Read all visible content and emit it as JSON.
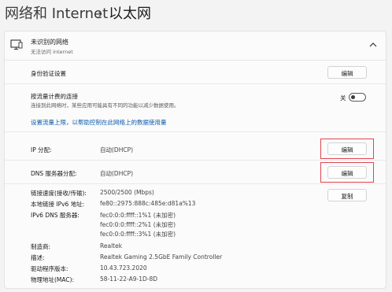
{
  "header": {
    "parent": "网络和 Internet",
    "separator": "›",
    "current": "以太网"
  },
  "network": {
    "name": "未识别的网络",
    "status": "无法访问 internet"
  },
  "auth": {
    "label": "身份验证设置",
    "button": "编辑"
  },
  "metered": {
    "label": "按流量计费的连接",
    "description": "连接到此网络时，某些应用可能具有不同的功能以减少数据使用。",
    "toggle_label": "关",
    "toggle_on": false
  },
  "data_limit_link": "设置流量上限，以帮助控制在此网络上的数据使用量",
  "ip": {
    "label": "IP 分配:",
    "value": "自动(DHCP)",
    "button": "编辑"
  },
  "dns": {
    "label": "DNS 服务器分配:",
    "value": "自动(DHCP)",
    "button": "编辑"
  },
  "props": {
    "copy_button": "复制",
    "link_speed": {
      "label": "链接速度(接收/传输):",
      "value": "2500/2500 (Mbps)"
    },
    "ipv6_local": {
      "label": "本地链接 IPv6 地址:",
      "value": "fe80::2975:888c:485e:d81a%13"
    },
    "ipv6_dns": {
      "label": "IPv6 DNS 服务器:",
      "values": [
        "fec0:0:0:ffff::1%1 (未加密)",
        "fec0:0:0:ffff::2%1 (未加密)",
        "fec0:0:0:ffff::3%1 (未加密)"
      ]
    },
    "manufacturer": {
      "label": "制造商:",
      "value": "Realtek"
    },
    "description": {
      "label": "描述:",
      "value": "Realtek Gaming 2.5GbE Family Controller"
    },
    "driver_version": {
      "label": "驱动程序版本:",
      "value": "10.43.723.2020"
    },
    "mac": {
      "label": "物理地址(MAC):",
      "value": "58-11-22-A9-1D-8D"
    }
  },
  "colors": {
    "highlight": "#e0464f",
    "link": "#0b5aa8"
  }
}
